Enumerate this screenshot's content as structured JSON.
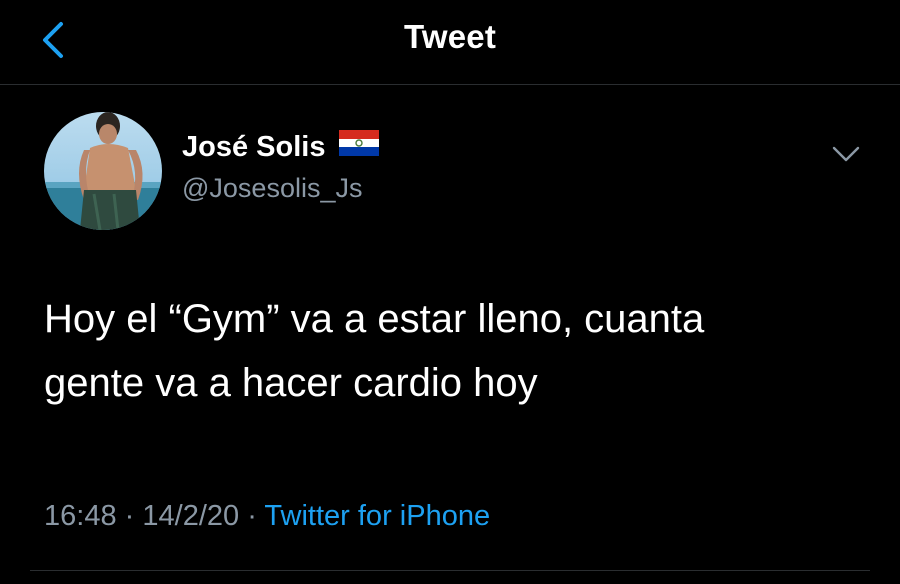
{
  "header": {
    "title": "Tweet",
    "back_icon": "chevron-left-icon",
    "accent_color": "#1da1f2"
  },
  "tweet": {
    "author": {
      "name": "José Solis",
      "flag_icon": "paraguay-flag-icon",
      "handle": "@Josesolis_Js"
    },
    "more_icon": "chevron-down-icon",
    "text_line_1": "Hoy el “Gym” va a estar lleno, cuanta",
    "text_line_2": "gente va a hacer cardio hoy",
    "time": "16:48",
    "sep1": "·",
    "date": "14/2/20",
    "sep2": "·",
    "source": "Twitter for iPhone"
  }
}
